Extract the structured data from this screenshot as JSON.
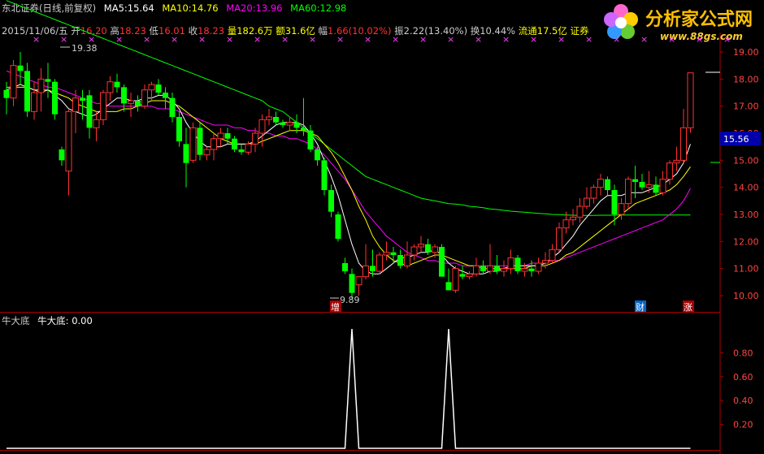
{
  "header": {
    "title": "东北证券(日线,前复权)",
    "ma5_label": "MA5:",
    "ma5_value": "15.64",
    "ma10_label": "MA10:",
    "ma10_value": "14.76",
    "ma20_label": "MA20:",
    "ma20_value": "13.96",
    "ma60_label": "MA60:",
    "ma60_value": "12.98",
    "colors": {
      "ma5": "#ffffff",
      "ma10": "#ffff00",
      "ma20": "#ff00ff",
      "ma60": "#00ff00"
    }
  },
  "info": {
    "date": "2015/11/06/五",
    "open_label": "开",
    "open": "16.20",
    "high_label": "高",
    "high": "18.23",
    "low_label": "低",
    "low": "16.01",
    "close_label": "收",
    "close": "18.23",
    "volume": "量182.6万",
    "amount": "额31.6亿",
    "change_label": "幅",
    "change": "1.66(10.02%)",
    "amplitude": "振2.22(13.40%)",
    "turnover": "换10.44%",
    "float": "流通17.5亿",
    "sector": "证券"
  },
  "logo": {
    "name": "分析家公式网",
    "url": "www.88gs.com"
  },
  "markers": {
    "max_label": "19.38",
    "min_label": "9.89",
    "price_tag": "15.56"
  },
  "event_tags": [
    "增",
    "财",
    "涨"
  ],
  "indicator": {
    "title": "牛大底",
    "line_label": "牛大底:",
    "line_value": "0.00"
  },
  "chart_data": [
    {
      "type": "candlestick",
      "ylim": [
        9.6,
        19.5
      ],
      "y_ticks": [
        10.0,
        11.0,
        12.0,
        13.0,
        14.0,
        15.0,
        16.0,
        17.0,
        18.0,
        19.0
      ],
      "colors": {
        "up": "#ff3232",
        "down": "#00ff00"
      },
      "candles": [
        [
          17.6,
          17.9,
          16.7,
          17.3
        ],
        [
          17.3,
          18.7,
          17.0,
          18.5
        ],
        [
          18.5,
          19.0,
          17.8,
          18.3
        ],
        [
          18.3,
          18.6,
          16.6,
          16.8
        ],
        [
          16.8,
          17.9,
          16.5,
          17.5
        ],
        [
          17.5,
          18.4,
          16.8,
          18.0
        ],
        [
          18.0,
          18.6,
          17.3,
          17.9
        ],
        [
          17.9,
          18.0,
          16.5,
          16.7
        ],
        [
          15.4,
          15.5,
          14.8,
          15.0
        ],
        [
          14.6,
          16.9,
          13.7,
          16.8
        ],
        [
          16.8,
          17.6,
          16.0,
          17.3
        ],
        [
          17.3,
          17.6,
          16.5,
          17.2
        ],
        [
          17.4,
          17.6,
          15.8,
          16.2
        ],
        [
          16.2,
          16.8,
          15.7,
          16.5
        ],
        [
          16.5,
          17.6,
          16.3,
          17.5
        ],
        [
          17.5,
          18.1,
          17.2,
          17.9
        ],
        [
          17.9,
          18.2,
          17.5,
          17.7
        ],
        [
          17.7,
          17.8,
          16.8,
          17.1
        ],
        [
          17.1,
          17.5,
          16.6,
          17.2
        ],
        [
          17.2,
          17.4,
          16.8,
          17.0
        ],
        [
          17.0,
          17.8,
          16.9,
          17.6
        ],
        [
          17.6,
          17.9,
          17.2,
          17.8
        ],
        [
          17.8,
          18.0,
          17.4,
          17.5
        ],
        [
          17.5,
          17.7,
          16.9,
          17.3
        ],
        [
          17.3,
          17.5,
          16.4,
          16.6
        ],
        [
          16.6,
          16.8,
          15.5,
          15.7
        ],
        [
          15.6,
          16.2,
          14.0,
          14.9
        ],
        [
          15.0,
          16.4,
          14.9,
          16.2
        ],
        [
          16.2,
          16.4,
          15.0,
          15.2
        ],
        [
          15.2,
          15.5,
          15.0,
          15.4
        ],
        [
          15.4,
          16.0,
          15.0,
          15.8
        ],
        [
          15.8,
          16.2,
          15.5,
          16.0
        ],
        [
          16.0,
          16.2,
          15.6,
          15.8
        ],
        [
          15.8,
          15.9,
          15.3,
          15.4
        ],
        [
          15.4,
          15.6,
          15.2,
          15.3
        ],
        [
          15.3,
          15.7,
          15.2,
          15.6
        ],
        [
          15.6,
          16.2,
          15.3,
          16.0
        ],
        [
          16.0,
          16.7,
          15.5,
          16.5
        ],
        [
          16.5,
          16.9,
          16.3,
          16.6
        ],
        [
          16.6,
          16.8,
          16.3,
          16.4
        ],
        [
          16.4,
          16.5,
          16.2,
          16.3
        ],
        [
          16.3,
          16.6,
          16.1,
          16.4
        ],
        [
          16.4,
          16.7,
          16.0,
          16.2
        ],
        [
          16.2,
          17.3,
          15.9,
          16.1
        ],
        [
          16.1,
          16.3,
          15.3,
          15.4
        ],
        [
          15.4,
          15.5,
          14.8,
          15.0
        ],
        [
          15.0,
          15.1,
          13.7,
          13.9
        ],
        [
          13.9,
          14.1,
          12.9,
          13.1
        ],
        [
          13.0,
          13.1,
          12.0,
          12.1
        ],
        [
          11.2,
          11.4,
          10.8,
          10.9
        ],
        [
          10.8,
          11.0,
          9.89,
          10.1
        ],
        [
          10.4,
          10.7,
          10.0,
          10.7
        ],
        [
          10.7,
          11.9,
          10.6,
          11.1
        ],
        [
          11.1,
          11.7,
          10.7,
          10.9
        ],
        [
          10.9,
          11.6,
          10.8,
          11.5
        ],
        [
          11.5,
          12.0,
          11.3,
          11.6
        ],
        [
          11.6,
          11.8,
          11.2,
          11.5
        ],
        [
          11.5,
          11.7,
          11.0,
          11.1
        ],
        [
          11.1,
          12.0,
          11.0,
          11.5
        ],
        [
          11.5,
          11.9,
          11.3,
          11.8
        ],
        [
          11.8,
          12.2,
          11.6,
          11.9
        ],
        [
          11.9,
          12.1,
          11.5,
          11.6
        ],
        [
          11.6,
          11.9,
          11.4,
          11.8
        ],
        [
          11.8,
          11.9,
          11.0,
          10.7
        ],
        [
          10.5,
          11.0,
          10.2,
          10.2
        ],
        [
          10.2,
          11.1,
          10.1,
          11.0
        ],
        [
          10.8,
          11.1,
          10.6,
          10.7
        ],
        [
          10.7,
          10.9,
          10.6,
          10.8
        ],
        [
          10.8,
          11.4,
          10.7,
          11.1
        ],
        [
          11.1,
          11.3,
          10.8,
          10.9
        ],
        [
          10.9,
          11.9,
          10.8,
          11.1
        ],
        [
          11.1,
          11.5,
          10.8,
          10.9
        ],
        [
          10.9,
          11.3,
          10.7,
          11.0
        ],
        [
          11.0,
          11.7,
          10.8,
          11.4
        ],
        [
          11.4,
          11.5,
          10.8,
          10.9
        ],
        [
          10.9,
          11.2,
          10.7,
          11.0
        ],
        [
          11.0,
          11.3,
          10.7,
          10.9
        ],
        [
          10.9,
          11.4,
          10.8,
          11.2
        ],
        [
          11.2,
          11.6,
          11.0,
          11.3
        ],
        [
          11.3,
          11.9,
          11.2,
          11.7
        ],
        [
          11.7,
          12.7,
          11.6,
          12.5
        ],
        [
          12.5,
          13.1,
          12.3,
          12.8
        ],
        [
          12.8,
          13.2,
          12.6,
          12.9
        ],
        [
          12.9,
          13.6,
          12.7,
          13.3
        ],
        [
          13.3,
          14.0,
          13.2,
          13.6
        ],
        [
          13.6,
          14.1,
          13.4,
          14.0
        ],
        [
          14.0,
          14.5,
          13.7,
          14.3
        ],
        [
          14.3,
          14.4,
          13.7,
          13.9
        ],
        [
          13.9,
          14.1,
          12.6,
          13.0
        ],
        [
          13.0,
          13.6,
          12.8,
          13.4
        ],
        [
          13.4,
          14.4,
          13.2,
          14.3
        ],
        [
          14.3,
          14.8,
          13.6,
          14.2
        ],
        [
          14.2,
          14.5,
          13.9,
          14.0
        ],
        [
          14.0,
          14.6,
          13.8,
          14.1
        ],
        [
          14.1,
          14.4,
          13.7,
          13.8
        ],
        [
          13.8,
          14.6,
          13.7,
          14.3
        ],
        [
          14.3,
          15.0,
          14.1,
          14.9
        ],
        [
          14.9,
          15.5,
          14.6,
          15.0
        ],
        [
          15.0,
          16.9,
          14.9,
          16.2
        ],
        [
          16.2,
          18.23,
          16.01,
          18.23
        ]
      ],
      "ma5": [
        17.6,
        17.7,
        17.8,
        17.7,
        17.6,
        17.5,
        17.6,
        17.4,
        17.2,
        16.9,
        16.8,
        16.7,
        16.6,
        16.7,
        16.9,
        17.1,
        17.3,
        17.3,
        17.2,
        17.2,
        17.3,
        17.3,
        17.4,
        17.4,
        17.2,
        16.9,
        16.4,
        16.0,
        15.7,
        15.5,
        15.5,
        15.5,
        15.6,
        15.6,
        15.6,
        15.6,
        15.7,
        15.9,
        16.1,
        16.3,
        16.4,
        16.4,
        16.4,
        16.3,
        16.0,
        15.6,
        15.0,
        14.4,
        13.7,
        12.8,
        11.9,
        11.2,
        10.9,
        10.8,
        10.8,
        11.0,
        11.2,
        11.4,
        11.4,
        11.5,
        11.6,
        11.6,
        11.7,
        11.5,
        11.2,
        11.0,
        10.9,
        10.8,
        10.8,
        10.8,
        10.9,
        10.9,
        11.0,
        11.1,
        11.1,
        11.1,
        11.1,
        11.1,
        11.2,
        11.4,
        11.6,
        11.9,
        12.2,
        12.6,
        12.9,
        13.2,
        13.5,
        13.7,
        13.7,
        13.7,
        13.8,
        13.8,
        13.8,
        13.9,
        14.0,
        14.1,
        14.3,
        14.5,
        14.9,
        15.6
      ],
      "ma10": [
        17.7,
        17.7,
        17.7,
        17.7,
        17.6,
        17.6,
        17.6,
        17.5,
        17.4,
        17.3,
        17.1,
        17.0,
        16.9,
        16.8,
        16.8,
        16.8,
        16.8,
        16.9,
        16.9,
        17.0,
        17.1,
        17.2,
        17.2,
        17.2,
        17.1,
        17.0,
        16.8,
        16.6,
        16.4,
        16.2,
        16.0,
        15.8,
        15.7,
        15.6,
        15.6,
        15.6,
        15.6,
        15.7,
        15.8,
        15.9,
        16.0,
        16.1,
        16.1,
        16.1,
        16.0,
        15.9,
        15.6,
        15.3,
        14.9,
        14.4,
        13.9,
        13.3,
        12.8,
        12.2,
        11.8,
        11.5,
        11.3,
        11.2,
        11.1,
        11.2,
        11.3,
        11.4,
        11.5,
        11.5,
        11.4,
        11.3,
        11.2,
        11.1,
        11.1,
        11.0,
        11.0,
        11.0,
        11.0,
        11.0,
        11.0,
        11.0,
        11.1,
        11.1,
        11.1,
        11.2,
        11.3,
        11.5,
        11.6,
        11.8,
        12.0,
        12.2,
        12.4,
        12.6,
        12.8,
        13.0,
        13.2,
        13.4,
        13.5,
        13.6,
        13.7,
        13.8,
        13.9,
        14.1,
        14.4,
        14.76
      ],
      "ma20": [
        18.3,
        18.2,
        18.1,
        18.0,
        17.9,
        17.8,
        17.7,
        17.7,
        17.6,
        17.5,
        17.4,
        17.3,
        17.2,
        17.1,
        17.1,
        17.0,
        17.0,
        17.0,
        17.0,
        17.0,
        17.0,
        17.0,
        16.9,
        16.9,
        16.9,
        16.8,
        16.7,
        16.6,
        16.5,
        16.4,
        16.3,
        16.3,
        16.3,
        16.2,
        16.2,
        16.1,
        16.1,
        16.0,
        16.0,
        15.9,
        15.9,
        15.8,
        15.8,
        15.7,
        15.6,
        15.4,
        15.2,
        14.9,
        14.6,
        14.3,
        13.9,
        13.5,
        13.1,
        12.8,
        12.5,
        12.2,
        12.0,
        11.8,
        11.6,
        11.5,
        11.4,
        11.3,
        11.3,
        11.2,
        11.2,
        11.2,
        11.1,
        11.1,
        11.1,
        11.1,
        11.1,
        11.1,
        11.1,
        11.1,
        11.1,
        11.1,
        11.2,
        11.2,
        11.2,
        11.3,
        11.3,
        11.4,
        11.5,
        11.6,
        11.7,
        11.8,
        11.9,
        12.0,
        12.1,
        12.2,
        12.3,
        12.4,
        12.5,
        12.6,
        12.7,
        12.8,
        13.0,
        13.2,
        13.5,
        13.96
      ],
      "ma60": [
        20.9,
        20.8,
        20.7,
        20.6,
        20.5,
        20.4,
        20.3,
        20.2,
        20.1,
        20.0,
        19.9,
        19.8,
        19.7,
        19.6,
        19.5,
        19.4,
        19.3,
        19.2,
        19.1,
        19.0,
        18.9,
        18.8,
        18.7,
        18.6,
        18.5,
        18.4,
        18.3,
        18.2,
        18.1,
        18.0,
        17.9,
        17.8,
        17.7,
        17.6,
        17.5,
        17.4,
        17.3,
        17.2,
        17.0,
        16.9,
        16.8,
        16.6,
        16.4,
        16.2,
        16.0,
        15.8,
        15.6,
        15.4,
        15.2,
        15.0,
        14.8,
        14.6,
        14.4,
        14.3,
        14.2,
        14.1,
        14.0,
        13.9,
        13.8,
        13.7,
        13.6,
        13.55,
        13.5,
        13.45,
        13.4,
        13.38,
        13.35,
        13.3,
        13.28,
        13.25,
        13.2,
        13.18,
        13.15,
        13.12,
        13.1,
        13.08,
        13.06,
        13.04,
        13.02,
        13.0,
        12.99,
        12.98,
        12.97,
        12.96,
        12.96,
        12.96,
        12.97,
        12.97,
        12.97,
        12.98,
        12.98,
        12.98,
        12.98,
        12.98,
        12.98,
        12.98,
        12.98,
        12.98,
        12.98,
        12.98
      ]
    },
    {
      "type": "line",
      "name": "牛大底",
      "ylim": [
        0,
        1.0
      ],
      "y_ticks": [
        0.2,
        0.4,
        0.6,
        0.8
      ],
      "color": "#ffffff",
      "values": [
        0,
        0,
        0,
        0,
        0,
        0,
        0,
        0,
        0,
        0,
        0,
        0,
        0,
        0,
        0,
        0,
        0,
        0,
        0,
        0,
        0,
        0,
        0,
        0,
        0,
        0,
        0,
        0,
        0,
        0,
        0,
        0,
        0,
        0,
        0,
        0,
        0,
        0,
        0,
        0,
        0,
        0,
        0,
        0,
        0,
        0,
        0,
        0,
        0,
        0,
        1,
        0,
        0,
        0,
        0,
        0,
        0,
        0,
        0,
        0,
        0,
        0,
        0,
        0,
        1,
        0,
        0,
        0,
        0,
        0,
        0,
        0,
        0,
        0,
        0,
        0,
        0,
        0,
        0,
        0,
        0,
        0,
        0,
        0,
        0,
        0,
        0,
        0,
        0,
        0,
        0,
        0,
        0,
        0,
        0,
        0,
        0,
        0,
        0,
        0
      ]
    }
  ]
}
